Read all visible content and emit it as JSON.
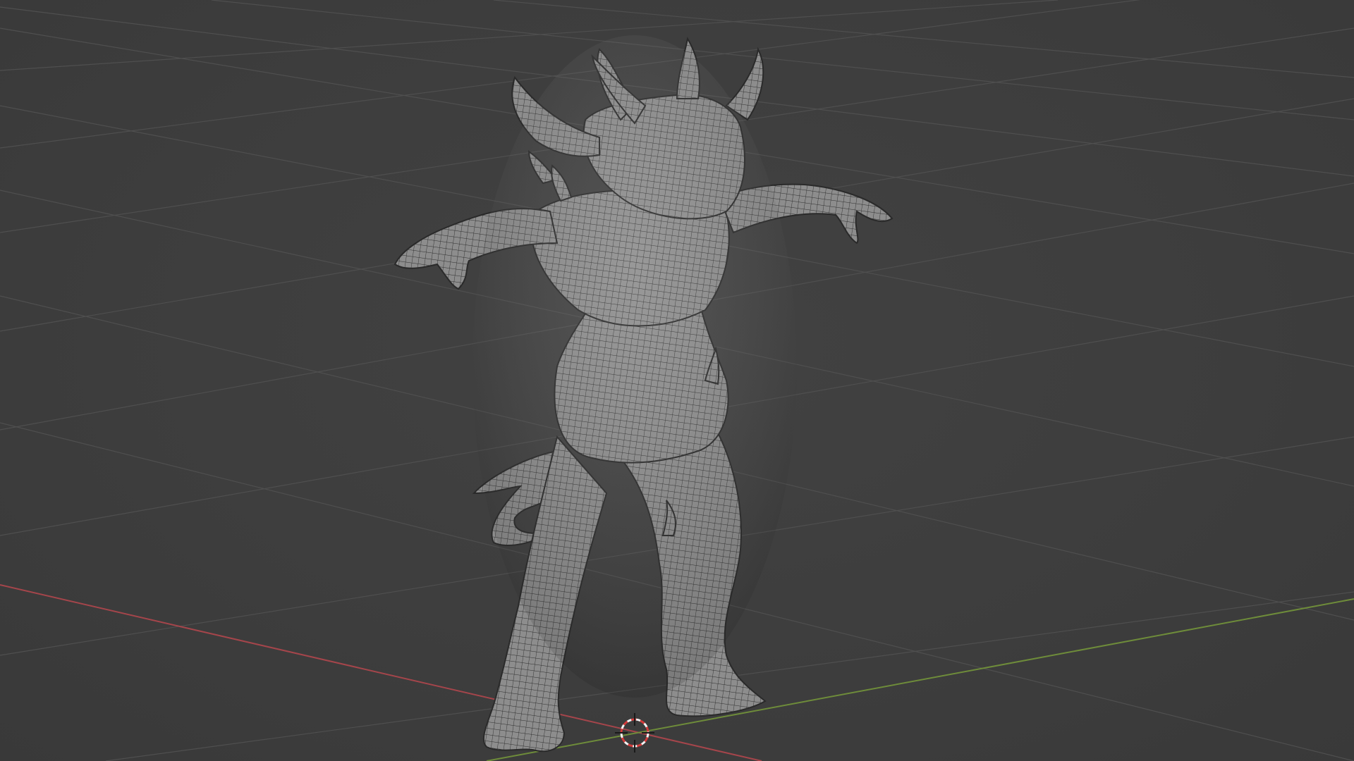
{
  "viewport": {
    "mode": "3d-viewport",
    "background_color": "#3d3d3d",
    "grid_color": "#555555",
    "x_axis_color": "#a5454b",
    "y_axis_color": "#6e8c3a",
    "mesh_color": "#8a8a8a",
    "wire_color": "#2a2a2a",
    "cursor_colors": [
      "#d33a3a",
      "#f2f2f2"
    ]
  },
  "object": {
    "type": "sculpted-mesh",
    "subject": "demon-creature",
    "shading": "solid-with-wireframe"
  }
}
